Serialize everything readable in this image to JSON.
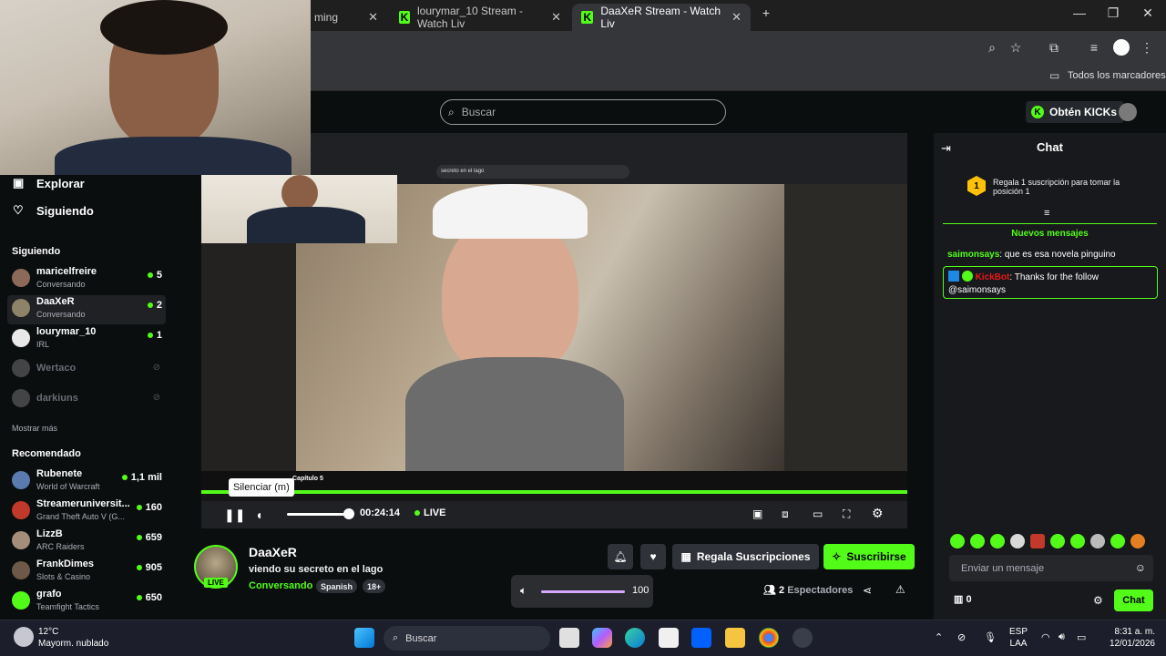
{
  "browser": {
    "tabs": [
      {
        "label": "ming",
        "active": false
      },
      {
        "label": "lourymar_10 Stream - Watch Liv",
        "active": false
      },
      {
        "label": "DaaXeR Stream - Watch Liv",
        "active": true
      }
    ],
    "bookmarks_label": "Todos los marcadores"
  },
  "header": {
    "search_placeholder": "Buscar",
    "get_kicks_label": "Obtén KICKs"
  },
  "sidebar": {
    "nav": [
      {
        "label": "Explorar"
      },
      {
        "label": "Siguiendo"
      }
    ],
    "following_title": "Siguiendo",
    "following": [
      {
        "name": "maricelfreire",
        "category": "Conversando",
        "viewers": "5"
      },
      {
        "name": "DaaXeR",
        "category": "Conversando",
        "viewers": "2"
      },
      {
        "name": "lourymar_10",
        "category": "IRL",
        "viewers": "1"
      },
      {
        "name": "Wertaco"
      },
      {
        "name": "darkiuns"
      }
    ],
    "show_more": "Mostrar más",
    "recommended_title": "Recomendado",
    "recommended": [
      {
        "name": "Rubenete",
        "category": "World of Warcraft",
        "viewers": "1,1 mil"
      },
      {
        "name": "Streameruniversit...",
        "category": "Grand Theft Auto V (G...",
        "viewers": "160"
      },
      {
        "name": "LizzB",
        "category": "ARC Raiders",
        "viewers": "659"
      },
      {
        "name": "FrankDimes",
        "category": "Slots & Casino",
        "viewers": "905"
      },
      {
        "name": "grafo",
        "category": "Teamfight Tactics",
        "viewers": "650"
      }
    ]
  },
  "player": {
    "tooltip": "Silenciar (m)",
    "time": "00:24:14",
    "live_label": "LIVE",
    "inner_search": "secreto en el lago",
    "inner_title": "Capítulo 5"
  },
  "stream": {
    "streamer": "DaaXeR",
    "live_badge": "LIVE",
    "title": "viendo su secreto en el lago",
    "category": "Conversando",
    "tags": [
      "Spanish",
      "18+"
    ],
    "gift_label": "Regala Suscripciones",
    "subscribe_label": "Suscribirse",
    "volume_value": "100",
    "viewers_count": "2",
    "viewers_label": "Espectadores"
  },
  "chat": {
    "title": "Chat",
    "pinned_rank": "1",
    "pinned_text": "Regala 1 suscripción para tomar la posición 1",
    "new_messages": "Nuevos mensajes",
    "messages": [
      {
        "user": "saimonsays",
        "text": "que es esa novela pinguino"
      },
      {
        "user": "KickBot",
        "text": "Thanks for the follow @saimonsays"
      }
    ],
    "input_placeholder": "Enviar un mensaje",
    "points": "0",
    "send_label": "Chat"
  },
  "taskbar": {
    "weather_temp": "12°C",
    "weather_desc": "Mayorm. nublado",
    "search_label": "Buscar",
    "lang_top": "ESP",
    "lang_bottom": "LAA",
    "time": "8:31 a. m.",
    "date": "12/01/2026"
  },
  "colors": {
    "kick_green": "#53fc18",
    "background": "#0b0e0f",
    "chat_bg": "#18191c"
  }
}
